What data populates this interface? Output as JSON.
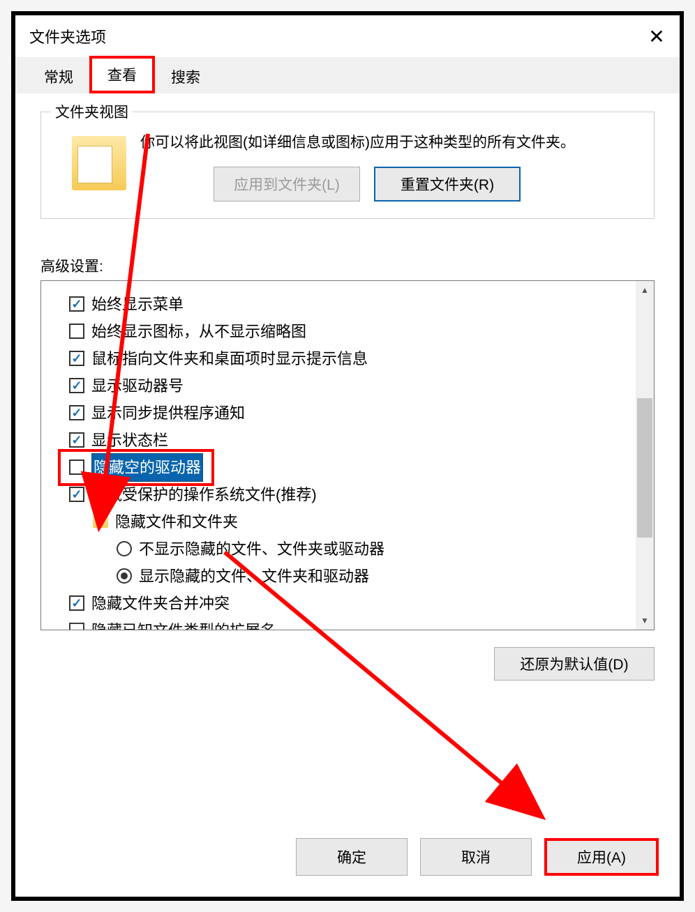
{
  "window": {
    "title": "文件夹选项"
  },
  "tabs": {
    "general": "常规",
    "view": "查看",
    "search": "搜索"
  },
  "folderView": {
    "groupLabel": "文件夹视图",
    "description": "你可以将此视图(如详细信息或图标)应用于这种类型的所有文件夹。",
    "applyToFolders": "应用到文件夹(L)",
    "resetFolders": "重置文件夹(R)"
  },
  "advanced": {
    "label": "高级设置:",
    "items": [
      {
        "type": "checkbox",
        "checked": true,
        "label": "始终显示菜单"
      },
      {
        "type": "checkbox",
        "checked": false,
        "label": "始终显示图标，从不显示缩略图"
      },
      {
        "type": "checkbox",
        "checked": true,
        "label": "鼠标指向文件夹和桌面项时显示提示信息"
      },
      {
        "type": "checkbox",
        "checked": true,
        "label": "显示驱动器号"
      },
      {
        "type": "checkbox",
        "checked": true,
        "label": "显示同步提供程序通知"
      },
      {
        "type": "checkbox",
        "checked": true,
        "label": "显示状态栏"
      },
      {
        "type": "checkbox",
        "checked": false,
        "label": "隐藏空的驱动器",
        "highlighted": true
      },
      {
        "type": "checkbox",
        "checked": true,
        "label": "隐藏受保护的操作系统文件(推荐)"
      },
      {
        "type": "folder",
        "label": "隐藏文件和文件夹"
      },
      {
        "type": "radio",
        "selected": false,
        "label": "不显示隐藏的文件、文件夹或驱动器",
        "indent": 2
      },
      {
        "type": "radio",
        "selected": true,
        "label": "显示隐藏的文件、文件夹和驱动器",
        "indent": 2
      },
      {
        "type": "checkbox",
        "checked": true,
        "label": "隐藏文件夹合并冲突"
      },
      {
        "type": "checkbox",
        "checked": false,
        "label": "隐藏已知文件类型的扩展名",
        "cutoff": true
      }
    ]
  },
  "restoreDefaults": "还原为默认值(D)",
  "footer": {
    "ok": "确定",
    "cancel": "取消",
    "apply": "应用(A)"
  }
}
